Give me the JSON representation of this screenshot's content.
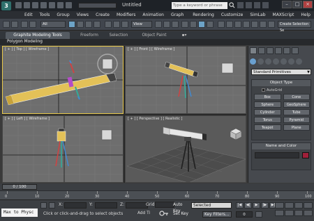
{
  "titlebar": {
    "logo": "3",
    "title": "Untitled",
    "search_placeholder": "Type a keyword or phrase",
    "window_controls": [
      "–",
      "□",
      "×"
    ]
  },
  "menu": [
    "Edit",
    "Tools",
    "Group",
    "Views",
    "Create",
    "Modifiers",
    "Animation",
    "Graph Editors",
    "Rendering",
    "Customize",
    "SimLab",
    "MAXScript",
    "Help"
  ],
  "toolbar": {
    "selection_filter": "All",
    "ref_coord": "View",
    "named_selection": "Create Selection Se"
  },
  "ribbon": {
    "tabs": [
      "Graphite Modeling Tools",
      "Freeform",
      "Selection",
      "Object Paint"
    ],
    "panel_label": "Polygon Modeling"
  },
  "viewports": {
    "top": "[ + ] [ Top ] [ Wireframe ]",
    "front": "[ + ] [ Front ] [ Wireframe ]",
    "left": "[ + ] [ Left ] [ Wireframe ]",
    "persp": "[ + ] [ Perspective ] [ Realistic ]"
  },
  "command_panel": {
    "primitive_type": "Standard Primitives",
    "object_type_title": "Object Type",
    "autogrid": "AutoGrid",
    "primitives": [
      "Box",
      "Cone",
      "Sphere",
      "GeoSphere",
      "Cylinder",
      "Tube",
      "Torus",
      "Pyramid",
      "Teapot",
      "Plane"
    ],
    "name_color_title": "Name and Color",
    "object_color": "#a0203a"
  },
  "timeline": {
    "frame_indicator": "0 / 100",
    "ticks": [
      "0",
      "10",
      "20",
      "30",
      "40",
      "50",
      "60",
      "70",
      "80",
      "90",
      "100"
    ]
  },
  "status": {
    "maxscript": "Max to Physc",
    "prompt": "Click or click-and-drag to select objects",
    "add_time_tag": "Add Ti",
    "x_label": "X:",
    "y_label": "Y:",
    "z_label": "Z:",
    "grid_label": "Grid",
    "auto_key": "Auto Key",
    "selected": "Selected",
    "set_key": "Set Key",
    "key_filters": "Key Filters...",
    "current_frame": "0"
  }
}
